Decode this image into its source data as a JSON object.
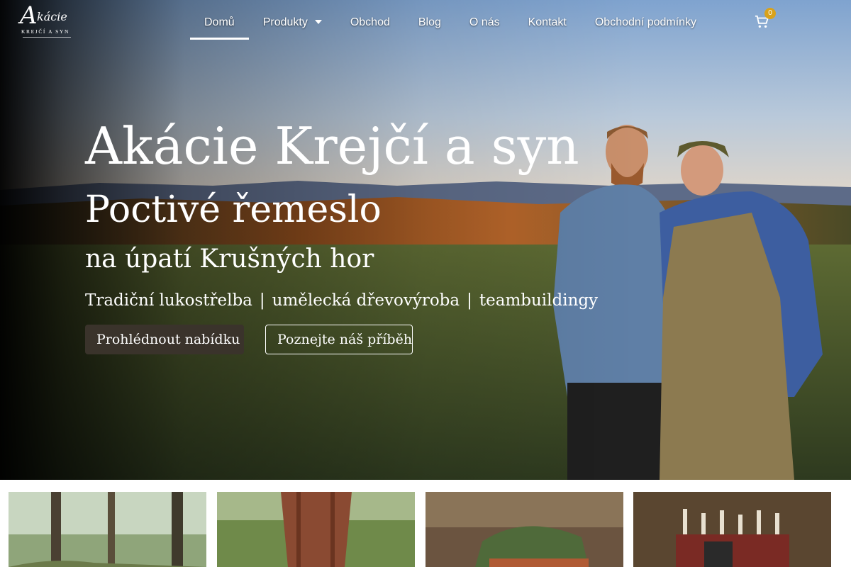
{
  "brand": {
    "logo_mark": "A",
    "logo_script": "kácie",
    "logo_sub": "KREJČÍ A SYN"
  },
  "nav": {
    "items": [
      {
        "label": "Domů",
        "active": true
      },
      {
        "label": "Produkty",
        "has_dropdown": true
      },
      {
        "label": "Obchod"
      },
      {
        "label": "Blog"
      },
      {
        "label": "O nás"
      },
      {
        "label": "Kontakt"
      },
      {
        "label": "Obchodní podmínky"
      }
    ],
    "cart_icon": "cart-icon",
    "cart_count": "0"
  },
  "hero": {
    "title": "Akácie Krejčí a syn",
    "subtitle": "Poctivé řemeslo",
    "subtitle2": "na úpatí Krušných hor",
    "tags": [
      "Tradiční lukostřelba",
      "umělecká dřevovýroba",
      "teambuildingy"
    ],
    "tag_separator": "|",
    "primary_button": "Prohlédnout nabídku",
    "secondary_button": "Poznejte náš příběh"
  },
  "colors": {
    "primary_button": "#3a332b",
    "cart_badge": "#d9a21b",
    "nav_text": "#ffffff"
  }
}
